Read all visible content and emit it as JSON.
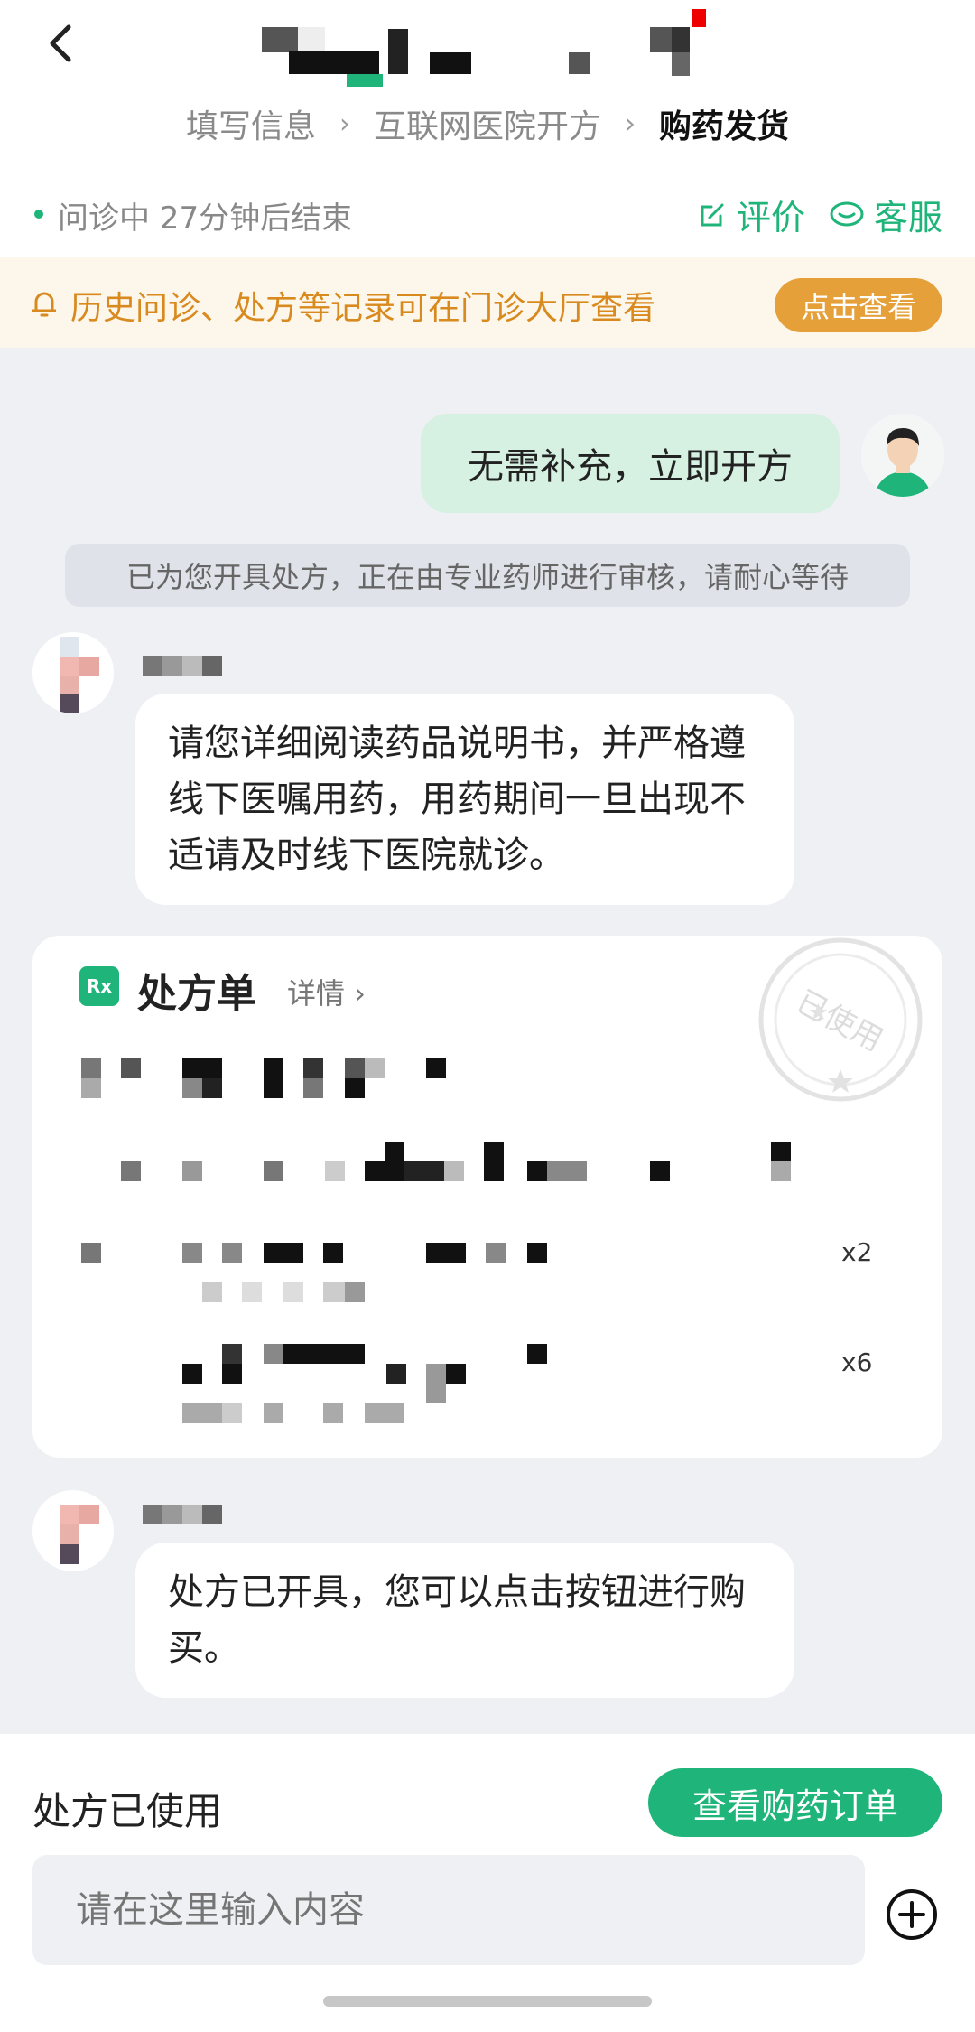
{
  "header": {
    "steps": [
      "填写信息",
      "互联网医院开方",
      "购药发货"
    ],
    "back_icon": "chevron-left-icon"
  },
  "status": {
    "text": "问诊中 27分钟后结束",
    "review_label": "评价",
    "service_label": "客服"
  },
  "notice": {
    "text": "历史问诊、处方等记录可在门诊大厅查看",
    "button": "点击查看"
  },
  "chat": {
    "user_message": "无需补充，立即开方",
    "system_message": "已为您开具处方，正在由专业药师进行审核，请耐心等待",
    "doctor_message_1": "请您详细阅读药品说明书，并严格遵线下医嘱用药，用药期间一旦出现不适请及时线下医院就诊。",
    "prescription": {
      "title": "处方单",
      "detail_link": "详情",
      "stamp_text": "已使用",
      "items": [
        {
          "quantity": "x2"
        },
        {
          "quantity": "x6"
        }
      ]
    },
    "doctor_message_2": "处方已开具，您可以点击按钮进行购买。"
  },
  "bottom": {
    "status_label": "处方已使用",
    "order_button": "查看购药订单",
    "input_placeholder": "请在这里输入内容"
  },
  "colors": {
    "brand_green": "#1fb57a",
    "notice_orange": "#d98a1f",
    "notice_bg": "#fdf6ea",
    "chat_bg": "#eef0f4",
    "user_bubble": "#d6f0e2"
  }
}
